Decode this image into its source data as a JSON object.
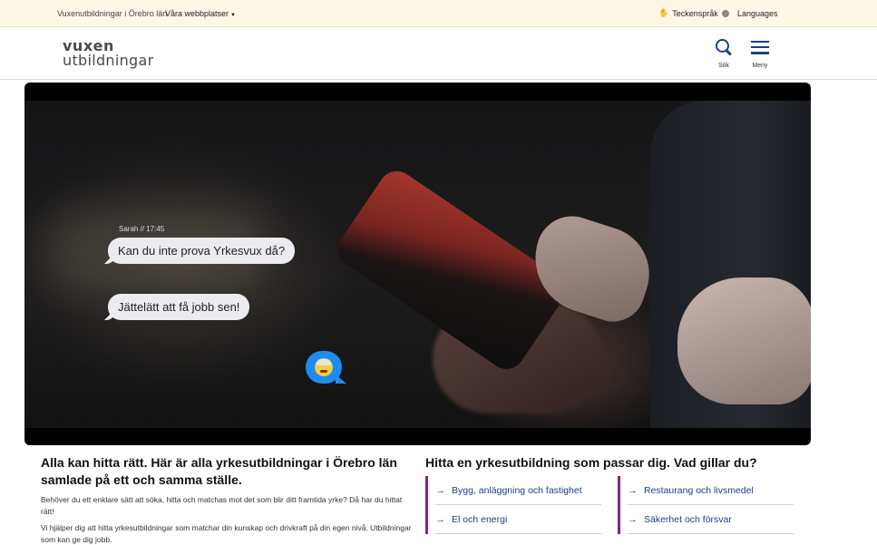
{
  "topbar": {
    "org_text": "Vuxenutbildningar i Örebro län",
    "sites_label": "Våra webbplatser",
    "sign_language_label": "Teckenspråk",
    "languages_label": "Languages"
  },
  "header": {
    "logo_line1": "vuxen",
    "logo_line2": "utbildningar",
    "search_label": "Sök",
    "menu_label": "Meny"
  },
  "video": {
    "chat_meta": "Sarah // 17:45",
    "message1": "Kan du inte prova Yrkesvux då?",
    "message2": "Jättelätt att få jobb sen!",
    "emoji": "mind-blown-emoji-icon"
  },
  "intro": {
    "heading": "Alla kan hitta rätt. Här är alla yrkesutbildningar i Örebro län samlade på ett och samma ställe.",
    "paragraph1": "Behöver du ett enklare sätt att söka, hitta och matchas mot det som blir ditt framtida yrke? Då har du hittat rätt!",
    "paragraph2": "Vi hjälper dig att hitta yrkesutbildningar som matchar din kunskap och drivkraft på din egen nivå. Utbildningar som kan ge dig jobb."
  },
  "finder": {
    "heading": "Hitta en yrkesutbildning som passar dig. Vad gillar du?",
    "left_items": [
      "Bygg, anläggning och fastighet",
      "El och energi"
    ],
    "right_items": [
      "Restaurang och livsmedel",
      "Säkerhet och försvar"
    ]
  },
  "colors": {
    "topbar_bg": "#fdf8e6",
    "brand_blue": "#1c3f85",
    "accent_purple": "#7a2a80",
    "chat_blue": "#1d8cf0"
  }
}
